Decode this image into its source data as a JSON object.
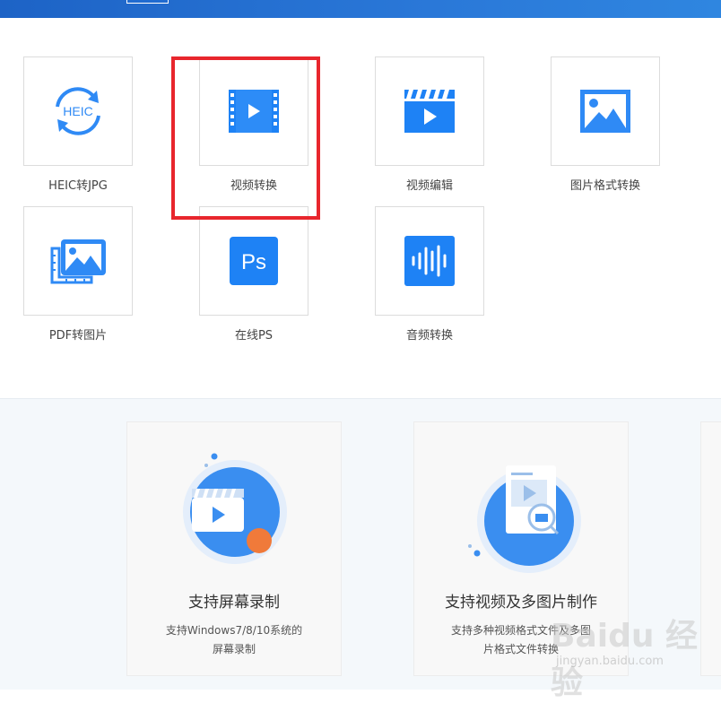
{
  "tools": [
    {
      "label": "HEIC转JPG",
      "icon": "heic-convert-icon",
      "icon_text": "HEIC"
    },
    {
      "label": "视频转换",
      "icon": "video-convert-icon"
    },
    {
      "label": "视频编辑",
      "icon": "video-edit-icon"
    },
    {
      "label": "图片格式转换",
      "icon": "image-format-icon"
    },
    {
      "label": "PDF转图片",
      "icon": "pdf-to-image-icon"
    },
    {
      "label": "在线PS",
      "icon": "photoshop-icon",
      "icon_text": "Ps"
    },
    {
      "label": "音频转换",
      "icon": "audio-convert-icon"
    }
  ],
  "features": [
    {
      "title": "支持屏幕录制",
      "desc_line1": "支持Windows7/8/10系统的",
      "desc_line2": "屏幕录制"
    },
    {
      "title": "支持视频及多图片制作",
      "desc_line1": "支持多种视频格式文件及多图",
      "desc_line2": "片格式文件转换"
    }
  ],
  "watermark": {
    "text": "Baidu 经验",
    "url": "jingyan.baidu.com"
  },
  "colors": {
    "accent": "#1e82f5",
    "highlight": "#e8262d",
    "topbar": "#1d63c6"
  }
}
